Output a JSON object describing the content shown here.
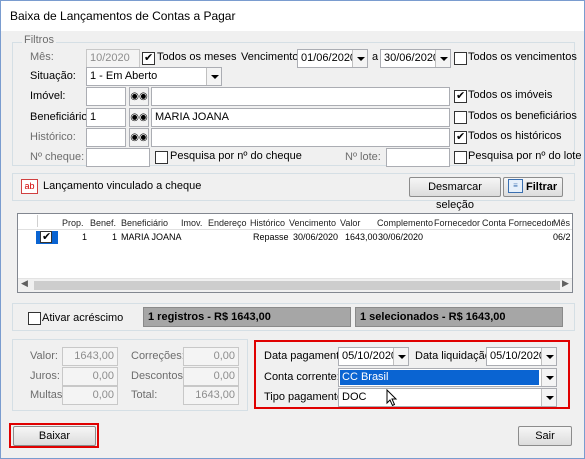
{
  "window": {
    "title": "Baixa de Lançamentos de Contas a Pagar"
  },
  "filters": {
    "legend": "Filtros",
    "mes_label": "Mês:",
    "mes_value": "10/2020",
    "todos_meses": "Todos os meses",
    "vencimento_label": "Vencimento:",
    "venc_from": "01/06/2020",
    "venc_sep": "a",
    "venc_to": "30/06/2020",
    "todos_vencimentos": "Todos os vencimentos",
    "situacao_label": "Situação:",
    "situacao_value": "1 - Em Aberto",
    "imovel_label": "Imóvel:",
    "todos_imoveis": "Todos os imóveis",
    "beneficiario_label": "Beneficiário:",
    "beneficiario_code": "1",
    "beneficiario_name": "MARIA JOANA",
    "todos_beneficiarios": "Todos os beneficiários",
    "historico_label": "Histórico:",
    "todos_historicos": "Todos os históricos",
    "cheque_label": "Nº cheque:",
    "pesquisa_cheque": "Pesquisa por nº do cheque",
    "lote_label": "Nº lote:",
    "pesquisa_lote": "Pesquisa por nº do lote"
  },
  "toolbar": {
    "vinculado_icon_text": "ab",
    "vinculado_label": "Lançamento vinculado a cheque",
    "desmarcar": "Desmarcar seleção",
    "filtrar": "Filtrar"
  },
  "grid": {
    "headers": [
      "Prop.",
      "Benef.",
      "Beneficiário",
      "Imov.",
      "Endereço",
      "Histórico",
      "Vencimento",
      "Valor",
      "Complemento",
      "Fornecedor",
      "Conta Fornecedor",
      "Mês"
    ],
    "rows": [
      {
        "prop": "1",
        "benef": "1",
        "beneficiario": "MARIA JOANA",
        "imov": "",
        "endereco": "",
        "historico": "Repasse",
        "vencimento": "30/06/2020",
        "valor": "1643,00",
        "complemento": "30/06/2020",
        "fornecedor": "",
        "conta": "",
        "mes": "06/2"
      }
    ]
  },
  "summary": {
    "ativar_acrescimo": "Ativar acréscimo",
    "registros": "1 registros - R$ 1643,00",
    "selecionados": "1 selecionados - R$ 1643,00"
  },
  "totals": {
    "valor_label": "Valor:",
    "valor": "1643,00",
    "juros_label": "Juros:",
    "juros": "0,00",
    "multas_label": "Multas:",
    "multas": "0,00",
    "correcoes_label": "Correções:",
    "correcoes": "0,00",
    "descontos_label": "Descontos:",
    "descontos": "0,00",
    "total_label": "Total:",
    "total": "1643,00"
  },
  "payment": {
    "data_pagamento_label": "Data pagamento:",
    "data_pagamento": "05/10/2020",
    "data_liquidacao_label": "Data liquidação:",
    "data_liquidacao": "05/10/2020",
    "conta_corrente_label": "Conta corrente:",
    "conta_corrente": "CC Brasil",
    "tipo_pagamento_label": "Tipo pagamento:",
    "tipo_pagamento": "DOC"
  },
  "footer": {
    "baixar": "Baixar",
    "sair": "Sair"
  },
  "colors": {
    "highlight_red": "#e00000",
    "selection_blue": "#0a64d2"
  }
}
